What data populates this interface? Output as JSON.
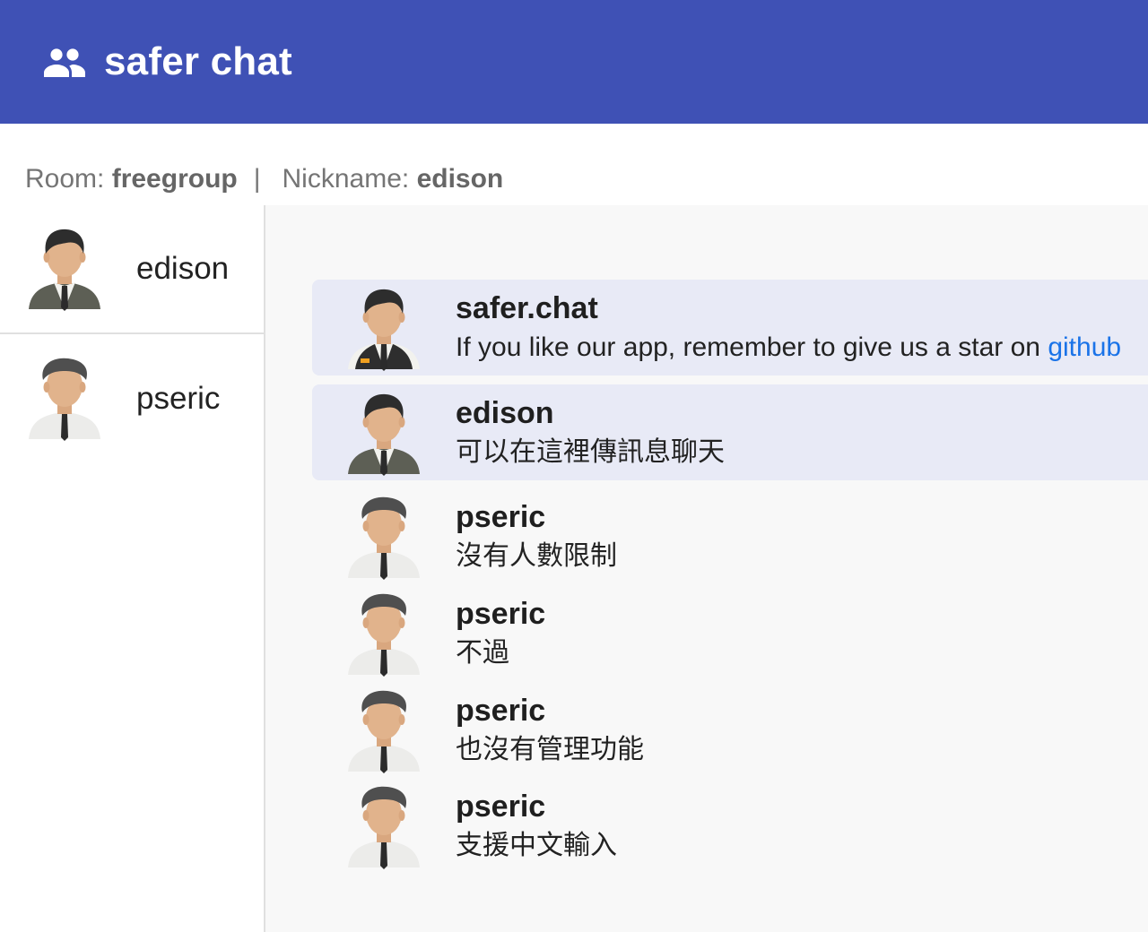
{
  "appbar": {
    "title": "safer chat",
    "icon": "group-icon",
    "color": "#3f51b5"
  },
  "info": {
    "room_label": "Room:",
    "room_value": "freegroup",
    "separator": "|",
    "nickname_label": "Nickname:",
    "nickname_value": "edison"
  },
  "members": [
    {
      "name": "edison",
      "avatar": "avatar-suit-icon"
    },
    {
      "name": "pseric",
      "avatar": "avatar-shirt-icon"
    }
  ],
  "messages": [
    {
      "author": "safer.chat",
      "text": "If you like our app, remember to give us a star on ",
      "link": "github",
      "highlight": true,
      "avatar": "avatar-vest-icon"
    },
    {
      "author": "edison",
      "text": "可以在這裡傳訊息聊天",
      "highlight": true,
      "avatar": "avatar-suit-icon"
    },
    {
      "author": "pseric",
      "text": "沒有人數限制",
      "highlight": false,
      "avatar": "avatar-shirt-icon"
    },
    {
      "author": "pseric",
      "text": "不過",
      "highlight": false,
      "avatar": "avatar-shirt-icon"
    },
    {
      "author": "pseric",
      "text": "也沒有管理功能",
      "highlight": false,
      "avatar": "avatar-shirt-icon"
    },
    {
      "author": "pseric",
      "text": "支援中文輸入",
      "highlight": false,
      "avatar": "avatar-shirt-icon"
    }
  ]
}
